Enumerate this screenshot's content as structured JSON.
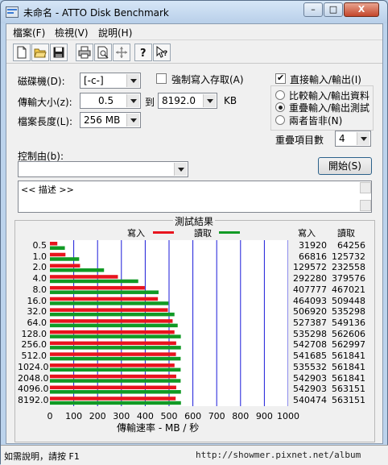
{
  "window": {
    "title": "未命名 - ATTO Disk Benchmark",
    "min": "–",
    "max": "□",
    "close": "X"
  },
  "menu": [
    "檔案(F)",
    "檢視(V)",
    "說明(H)"
  ],
  "toolbar": [
    {
      "name": "new-file-icon"
    },
    {
      "name": "open-folder-icon"
    },
    {
      "name": "save-icon"
    },
    {
      "name": "print-icon"
    },
    {
      "name": "print-preview-icon"
    },
    {
      "name": "move-icon"
    },
    {
      "name": "help-icon"
    },
    {
      "name": "context-help-icon"
    }
  ],
  "form": {
    "drive_label": "磁碟機(D):",
    "drive_value": "[-c-]",
    "force_write_label": "強制寫入存取(A)",
    "force_write_checked": false,
    "direct_io_label": "直接輸入/輸出(I)",
    "direct_io_checked": true,
    "transfer_size_label": "傳輸大小(z):",
    "transfer_from": "0.5",
    "to_label": "到",
    "transfer_to": "8192.0",
    "unit": "KB",
    "file_length_label": "檔案長度(L):",
    "file_length": "256 MB",
    "radio_compare": "比較輸入/輸出資料",
    "radio_overlap": "重疊輸入/輸出測試",
    "radio_neither": "兩者皆非(N)",
    "selected_radio": "overlap",
    "queue_depth_label": "重疊項目數",
    "queue_depth": "4",
    "controlled_by_label": "控制由(b):",
    "controlled_by_value": "",
    "start_button": "開始(S)",
    "description": "<< 描述 >>"
  },
  "results": {
    "title": "測試結果",
    "legend_write": "寫入",
    "legend_read": "讀取",
    "col_write": "寫入",
    "col_read": "讀取",
    "colors": {
      "write": "#e8141e",
      "read": "#119a25",
      "grid": "#1a1ad9"
    }
  },
  "chart_data": {
    "type": "bar",
    "orientation": "horizontal",
    "categories": [
      "0.5",
      "1.0",
      "2.0",
      "4.0",
      "8.0",
      "16.0",
      "32.0",
      "64.0",
      "128.0",
      "256.0",
      "512.0",
      "1024.0",
      "2048.0",
      "4096.0",
      "8192.0"
    ],
    "series": [
      {
        "name": "寫入",
        "values": [
          31920,
          66816,
          129572,
          292280,
          407777,
          464093,
          506920,
          527387,
          535298,
          542708,
          541685,
          535532,
          542903,
          542903,
          540474
        ]
      },
      {
        "name": "讀取",
        "values": [
          64256,
          125732,
          232558,
          379576,
          467021,
          509448,
          535298,
          549136,
          562606,
          562997,
          561841,
          561841,
          561841,
          563151,
          563151
        ]
      }
    ],
    "x_ticks": [
      "0",
      "100",
      "200",
      "300",
      "400",
      "500",
      "600",
      "700",
      "800",
      "900",
      "1000"
    ],
    "xlabel": "傳輸速率 - MB / 秒",
    "xlim": [
      0,
      1000
    ],
    "value_unit": "KB/s",
    "grid": true
  },
  "status": {
    "text": "如需說明，請按 F1",
    "watermark": "http://showmer.pixnet.net/album"
  }
}
